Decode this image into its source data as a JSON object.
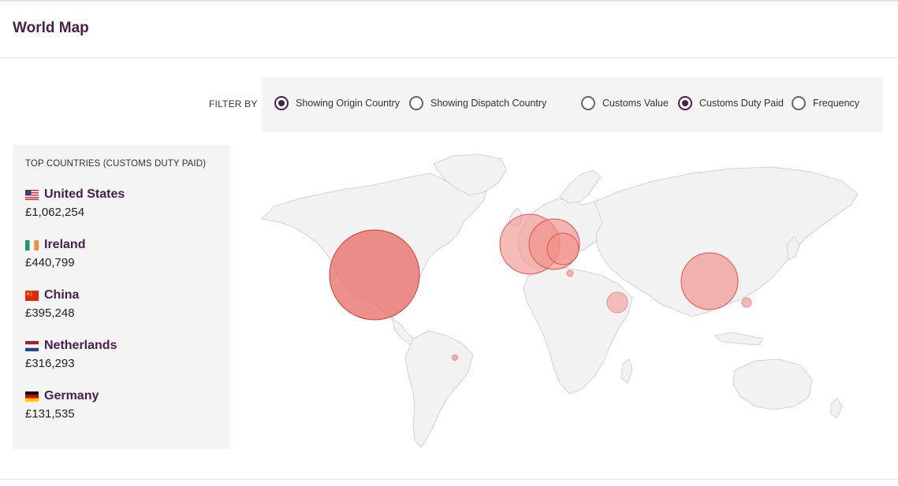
{
  "header": {
    "title": "World Map"
  },
  "filter": {
    "label": "FILTER BY",
    "options": [
      {
        "label": "Showing Origin Country",
        "checked": true
      },
      {
        "label": "Showing Dispatch Country",
        "checked": false
      },
      {
        "label": "Customs Value",
        "checked": false
      },
      {
        "label": "Customs Duty Paid",
        "checked": true
      },
      {
        "label": "Frequency",
        "checked": false
      }
    ]
  },
  "panel": {
    "title": "TOP COUNTRIES (CUSTOMS DUTY PAID)",
    "countries": [
      {
        "name": "United States",
        "value": "£1,062,254",
        "flag": "us-flag-icon"
      },
      {
        "name": "Ireland",
        "value": "£440,799",
        "flag": "ireland-flag-icon"
      },
      {
        "name": "China",
        "value": "£395,248",
        "flag": "china-flag-icon"
      },
      {
        "name": "Netherlands",
        "value": "£316,293",
        "flag": "netherlands-flag-icon"
      },
      {
        "name": "Germany",
        "value": "£131,535",
        "flag": "germany-flag-icon"
      }
    ]
  },
  "colors": {
    "accent": "#4b1d4f",
    "bubble_fill": "#e8706a",
    "bubble_stroke": "#d63a34",
    "land": "#f2f2f2",
    "land_stroke": "#c9c9c9"
  }
}
